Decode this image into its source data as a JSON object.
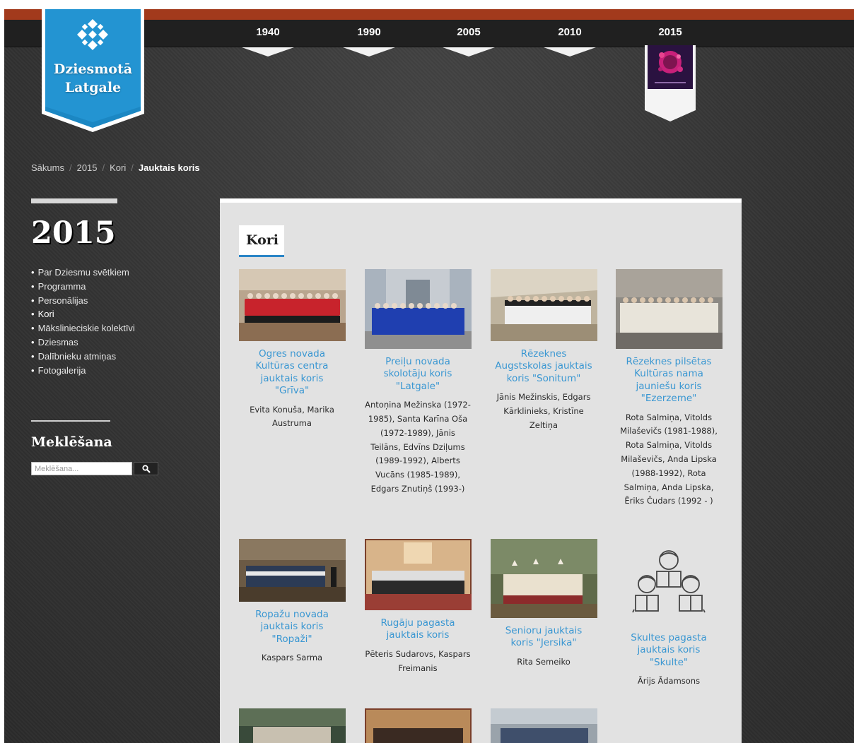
{
  "logo": {
    "title_line1": "Dziesmotā",
    "title_line2": "Latgale"
  },
  "years": [
    "1940",
    "1990",
    "2005",
    "2010",
    "2015"
  ],
  "breadcrumb": {
    "items": [
      "Sākums",
      "2015",
      "Kori"
    ],
    "current": "Jauktais koris",
    "separator": "/"
  },
  "sidebar": {
    "year": "2015",
    "menu": [
      "Par Dziesmu svētkiem",
      "Programma",
      "Personālijas",
      "Kori",
      "Mākslinieciskie kolektīvi",
      "Dziesmas",
      "Dalībnieku atmiņas",
      "Fotogalerija"
    ],
    "search_title": "Meklēšana",
    "search_placeholder": "Meklēšana..."
  },
  "content": {
    "heading": "Kori",
    "cards": [
      {
        "title": "Ogres novada Kultūras centra jauktais koris \"Grīva\"",
        "desc": "Evita Konuša, Marika Austruma",
        "photo": "red-choir"
      },
      {
        "title": "Preiļu novada skolotāju koris \"Latgale\"",
        "desc": "Antoņina Mežinska (1972-1985), Santa Karīna Oša (1972-1989), Jānis Teilāns, Edvīns Dziļums (1989-1992), Alberts Vucāns (1985-1989), Edgars Znutiņš (1993-)",
        "photo": "blue-choir"
      },
      {
        "title": "Rēzeknes Augstskolas jauktais koris \"Sonitum\"",
        "desc": "Jānis Mežinskis, Edgars Kārklinieks, Kristīne Zeltiņa",
        "photo": "hall-choir"
      },
      {
        "title": "Rēzeknes pilsētas Kultūras nama jauniešu koris \"Ezerzeme\"",
        "desc": "Rota Salmiņa, Vitolds Milaševičs (1981-1988), Rota Salmiņa, Vitolds Milaševičs, Anda Lipska (1988-1992), Rota Salmiņa, Anda Lipska, Ēriks Čudars (1992 - )",
        "photo": "folk-choir"
      },
      {
        "title": "Ropažu novada jauktais koris \"Ropaži\"",
        "desc": "Kaspars Sarma",
        "photo": "stage-choir"
      },
      {
        "title": "Rugāju pagasta jauktais koris",
        "desc": "Pēteris Sudarovs, Kaspars Freimanis",
        "photo": "church-choir"
      },
      {
        "title": "Senioru jauktais koris \"Jersika\"",
        "desc": "Rita Semeiko",
        "photo": "outdoor-choir"
      },
      {
        "title": "Skultes pagasta jauktais koris \"Skulte\"",
        "desc": "Ārijs Ādamsons",
        "photo": "placeholder-icon"
      }
    ]
  }
}
